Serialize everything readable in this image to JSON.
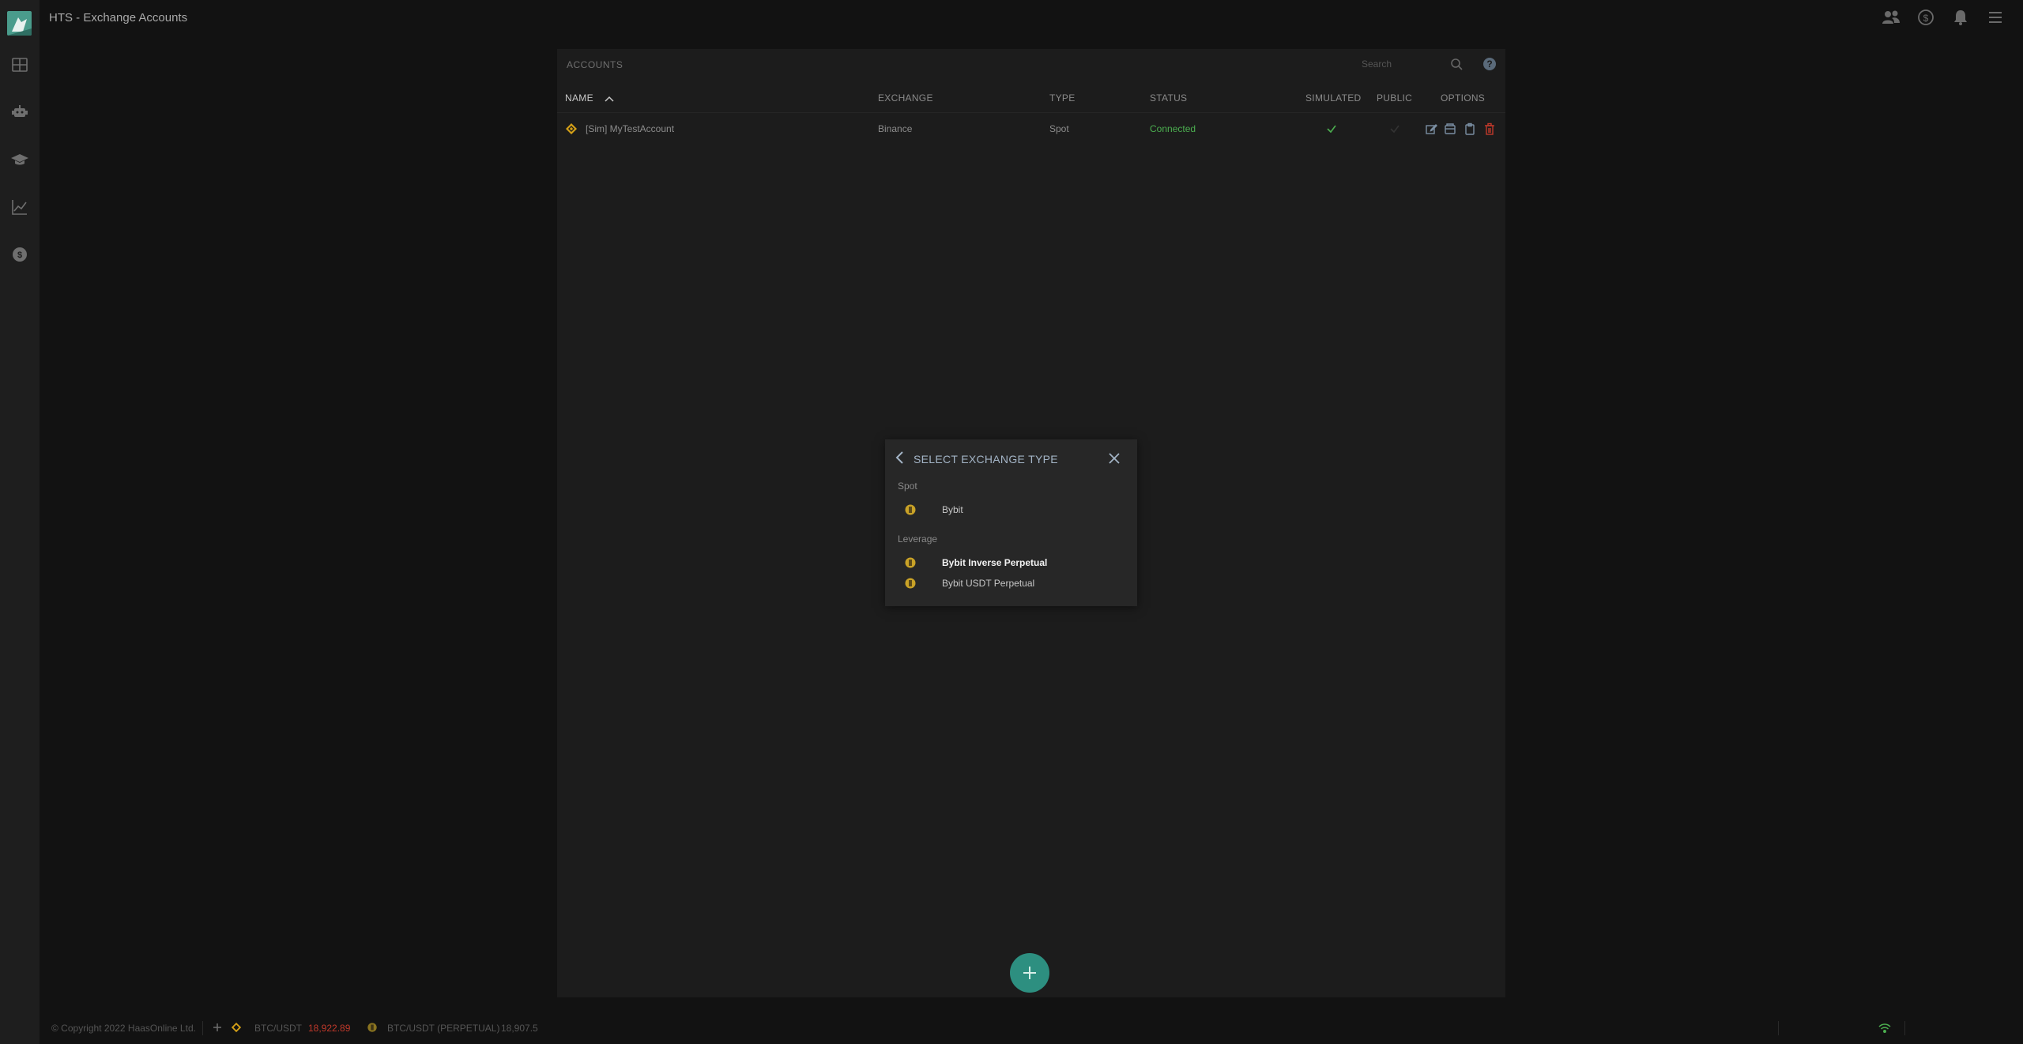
{
  "app": {
    "title": "HTS - Exchange Accounts"
  },
  "sidebar": {
    "items": [
      {
        "name": "dashboard",
        "icon": "grid-icon"
      },
      {
        "name": "bots",
        "icon": "robot-icon"
      },
      {
        "name": "education",
        "icon": "graduation-cap-icon"
      },
      {
        "name": "charts",
        "icon": "line-chart-icon"
      },
      {
        "name": "wallet",
        "icon": "coin-icon"
      }
    ]
  },
  "topbar": {
    "icons": [
      "users-icon",
      "dollar-icon",
      "bell-icon",
      "menu-icon"
    ]
  },
  "accounts": {
    "title": "ACCOUNTS",
    "search_placeholder": "Search",
    "help": "?",
    "columns": {
      "name": "NAME",
      "exchange": "EXCHANGE",
      "type": "TYPE",
      "status": "STATUS",
      "simulated": "SIMULATED",
      "public": "PUBLIC",
      "options": "OPTIONS"
    },
    "rows": [
      {
        "name": "[Sim] MyTestAccount",
        "exchange": "Binance",
        "type": "Spot",
        "status": "Connected",
        "simulated": true,
        "public": false
      }
    ]
  },
  "dialog": {
    "title": "SELECT EXCHANGE TYPE",
    "groups": [
      {
        "label": "Spot",
        "items": [
          "Bybit"
        ]
      },
      {
        "label": "Leverage",
        "items": [
          "Bybit Inverse Perpetual",
          "Bybit USDT Perpetual"
        ]
      }
    ]
  },
  "fab": {
    "icon": "plus-icon"
  },
  "footer": {
    "copyright": "© Copyright 2022 HaasOnline Ltd.",
    "ticker1_pair": "BTC/USDT",
    "ticker1_price": "18,922.89",
    "ticker2_pair": "BTC/USDT (PERPETUAL)",
    "ticker2_price": "18,907.5"
  },
  "colors": {
    "accent": "#2d8f80",
    "connected": "#4caf50",
    "price_down": "#c0392b",
    "binance": "#d4a017",
    "delete": "#c0392b"
  }
}
